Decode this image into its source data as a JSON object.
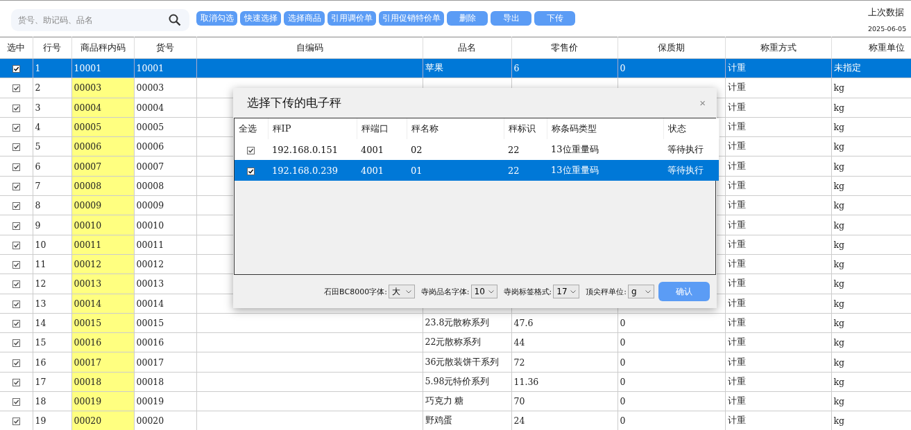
{
  "search": {
    "placeholder": "货号、助记码、品名"
  },
  "toolbar": [
    "取消勾选",
    "快速选择",
    "选择商品",
    "引用调价单",
    "引用促销特价单",
    "删除",
    "导出",
    "下传"
  ],
  "last_sync": {
    "label": "上次数据",
    "date": "2025-06-05"
  },
  "table": {
    "columns": [
      "选中",
      "行号",
      "商品秤内码",
      "货号",
      "自编码",
      "品名",
      "零售价",
      "保质期",
      "称重方式",
      "称重单位"
    ],
    "rows": [
      {
        "checked": true,
        "selected": true,
        "line": "1",
        "scale_code": "10001",
        "item_no": "10001",
        "name": "苹果",
        "price": "6",
        "shelf_life": "0",
        "weigh_mode": "计重",
        "unit": "未指定"
      },
      {
        "checked": true,
        "selected": false,
        "line": "2",
        "scale_code": "00003",
        "item_no": "00003",
        "weigh_mode": "计重",
        "unit": "kg"
      },
      {
        "checked": true,
        "selected": false,
        "line": "3",
        "scale_code": "00004",
        "item_no": "00004",
        "weigh_mode": "计重",
        "unit": "kg"
      },
      {
        "checked": true,
        "selected": false,
        "line": "4",
        "scale_code": "00005",
        "item_no": "00005",
        "weigh_mode": "计重",
        "unit": "kg"
      },
      {
        "checked": true,
        "selected": false,
        "line": "5",
        "scale_code": "00006",
        "item_no": "00006",
        "weigh_mode": "计重",
        "unit": "kg"
      },
      {
        "checked": true,
        "selected": false,
        "line": "6",
        "scale_code": "00007",
        "item_no": "00007",
        "weigh_mode": "计重",
        "unit": "kg"
      },
      {
        "checked": true,
        "selected": false,
        "line": "7",
        "scale_code": "00008",
        "item_no": "00008",
        "weigh_mode": "计重",
        "unit": "kg"
      },
      {
        "checked": true,
        "selected": false,
        "line": "8",
        "scale_code": "00009",
        "item_no": "00009",
        "weigh_mode": "计重",
        "unit": "kg"
      },
      {
        "checked": true,
        "selected": false,
        "line": "9",
        "scale_code": "00010",
        "item_no": "00010",
        "weigh_mode": "计重",
        "unit": "kg"
      },
      {
        "checked": true,
        "selected": false,
        "line": "10",
        "scale_code": "00011",
        "item_no": "00011",
        "weigh_mode": "计重",
        "unit": "kg"
      },
      {
        "checked": true,
        "selected": false,
        "line": "11",
        "scale_code": "00012",
        "item_no": "00012",
        "weigh_mode": "计重",
        "unit": "kg"
      },
      {
        "checked": true,
        "selected": false,
        "line": "12",
        "scale_code": "00013",
        "item_no": "00013",
        "weigh_mode": "计重",
        "unit": "kg"
      },
      {
        "checked": true,
        "selected": false,
        "line": "13",
        "scale_code": "00014",
        "item_no": "00014",
        "weigh_mode": "计重",
        "unit": "kg"
      },
      {
        "checked": true,
        "selected": false,
        "line": "14",
        "scale_code": "00015",
        "item_no": "00015",
        "name": "23.8元散称系列",
        "price": "47.6",
        "shelf_life": "0",
        "weigh_mode": "计重",
        "unit": "kg"
      },
      {
        "checked": true,
        "selected": false,
        "line": "15",
        "scale_code": "00016",
        "item_no": "00016",
        "name": "22元散称系列",
        "price": "44",
        "shelf_life": "0",
        "weigh_mode": "计重",
        "unit": "kg"
      },
      {
        "checked": true,
        "selected": false,
        "line": "16",
        "scale_code": "00017",
        "item_no": "00017",
        "name": "36元散装饼干系列",
        "price": "72",
        "shelf_life": "0",
        "weigh_mode": "计重",
        "unit": "kg"
      },
      {
        "checked": true,
        "selected": false,
        "line": "17",
        "scale_code": "00018",
        "item_no": "00018",
        "name": "5.98元特价系列",
        "price": "11.36",
        "shelf_life": "0",
        "weigh_mode": "计重",
        "unit": "kg"
      },
      {
        "checked": true,
        "selected": false,
        "line": "18",
        "scale_code": "00019",
        "item_no": "00019",
        "name": "巧克力 糖",
        "price": "70",
        "shelf_life": "0",
        "weigh_mode": "计重",
        "unit": "kg"
      },
      {
        "checked": true,
        "selected": false,
        "line": "19",
        "scale_code": "00020",
        "item_no": "00020",
        "name": "野鸡蛋",
        "price": "24",
        "shelf_life": "0",
        "weigh_mode": "计重",
        "unit": "kg"
      }
    ]
  },
  "dialog": {
    "title": "选择下传的电子秤",
    "close": "×",
    "columns": [
      "全选",
      "秤IP",
      "秤端口",
      "秤名称",
      "秤标识",
      "称条码类型",
      "状态"
    ],
    "rows": [
      {
        "checked": true,
        "selected": false,
        "ip": "192.168.0.151",
        "port": "4001",
        "scale_name": "02",
        "scale_id": "22",
        "barcode_type": "13位重量码",
        "status": "等待执行"
      },
      {
        "checked": true,
        "selected": true,
        "ip": "192.168.0.239",
        "port": "4001",
        "scale_name": "01",
        "scale_id": "22",
        "barcode_type": "13位重量码",
        "status": "等待执行"
      }
    ],
    "options": [
      {
        "label": "石田BC8000字体:",
        "value": "大"
      },
      {
        "label": "寺岗品名字体:",
        "value": "10"
      },
      {
        "label": "寺岗标签格式:",
        "value": "17"
      },
      {
        "label": "顶尖秤单位:",
        "value": "g"
      }
    ],
    "confirm": "确认"
  }
}
